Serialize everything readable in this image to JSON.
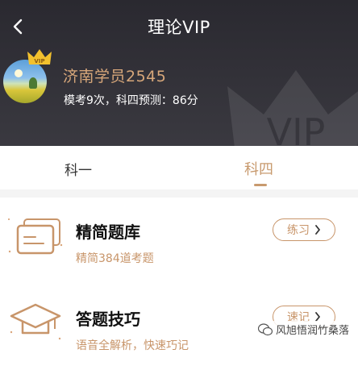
{
  "header": {
    "title": "理论VIP",
    "username": "济南学员2545",
    "stats": "模考9次，科四预测：86分",
    "crown_label": "VIP",
    "watermark_text": "VIP"
  },
  "tabs": [
    {
      "label": "科一",
      "active": false
    },
    {
      "label": "科四",
      "active": true
    }
  ],
  "cards": [
    {
      "title": "精简题库",
      "subtitle": "精简384道考题",
      "button_label": "练习"
    },
    {
      "title": "答题技巧",
      "subtitle": "语音全解析，快速巧记",
      "button_label": "速记"
    }
  ],
  "watermark": {
    "label": "风旭悟润竹桑落"
  },
  "colors": {
    "accent": "#c8956a",
    "header_bg": "#2e2d33",
    "gold": "#f2c12e"
  }
}
